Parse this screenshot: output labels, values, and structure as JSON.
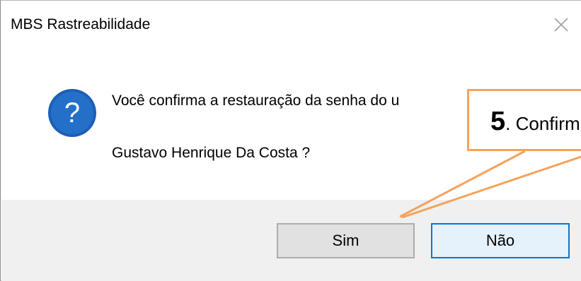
{
  "window": {
    "title": "MBS Rastreabilidade",
    "close_icon": "close-icon"
  },
  "dialog": {
    "icon": "question-icon",
    "message_line1": "Você confirma a restauração da senha do u",
    "message_line2": "Gustavo Henrique Da Costa ?"
  },
  "buttons": {
    "yes_label": "Sim",
    "no_label": "Não"
  },
  "annotation": {
    "step_number": "5",
    "step_text": ". Confirm",
    "accent_color": "#f3a35b"
  }
}
